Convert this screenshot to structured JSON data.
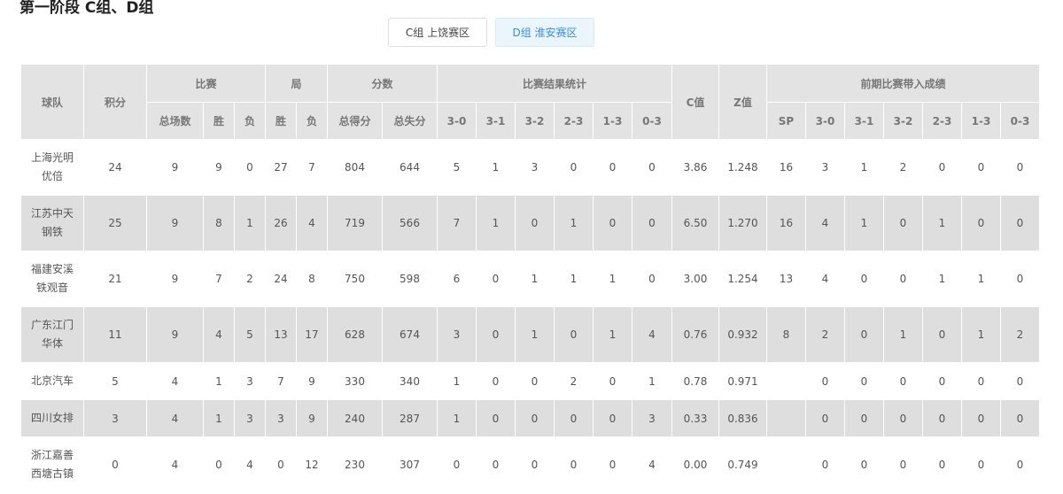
{
  "page_title": "第一阶段 C组、D组",
  "tabs": [
    {
      "label": "C组 上饶赛区",
      "active": false
    },
    {
      "label": "D组 淮安赛区",
      "active": true
    }
  ],
  "colors": {
    "active_tab_bg": "#eaf5fc",
    "active_tab_text": "#3a8ee6",
    "header_bg": "#e3e3e3",
    "stripe_bg": "#dedede"
  },
  "table": {
    "groups": {
      "team": "球队",
      "points": "积分",
      "matches": "比赛",
      "sets": "局",
      "scores": "分数",
      "result_stats": "比赛结果统计",
      "c_value": "C值",
      "z_value": "Z值",
      "prior": "前期比赛带入成绩"
    },
    "sub": {
      "matches": [
        "总场数",
        "胜",
        "负"
      ],
      "sets": [
        "胜",
        "负"
      ],
      "scores": [
        "总得分",
        "总失分"
      ],
      "result_stats": [
        "3-0",
        "3-1",
        "3-2",
        "2-3",
        "1-3",
        "0-3"
      ],
      "prior": [
        "SP",
        "3-0",
        "3-1",
        "3-2",
        "2-3",
        "1-3",
        "0-3"
      ]
    },
    "rows": [
      {
        "team": [
          "上海光明",
          "优倍"
        ],
        "cells": [
          "24",
          "9",
          "9",
          "0",
          "27",
          "7",
          "804",
          "644",
          "5",
          "1",
          "3",
          "0",
          "0",
          "0",
          "3.86",
          "1.248",
          "16",
          "3",
          "1",
          "2",
          "0",
          "0",
          "0"
        ]
      },
      {
        "team": [
          "江苏中天",
          "钢铁"
        ],
        "cells": [
          "25",
          "9",
          "8",
          "1",
          "26",
          "4",
          "719",
          "566",
          "7",
          "1",
          "0",
          "1",
          "0",
          "0",
          "6.50",
          "1.270",
          "16",
          "4",
          "1",
          "0",
          "1",
          "0",
          "0"
        ]
      },
      {
        "team": [
          "福建安溪",
          "铁观音"
        ],
        "cells": [
          "21",
          "9",
          "7",
          "2",
          "24",
          "8",
          "750",
          "598",
          "6",
          "0",
          "1",
          "1",
          "1",
          "0",
          "3.00",
          "1.254",
          "13",
          "4",
          "0",
          "0",
          "1",
          "1",
          "0"
        ]
      },
      {
        "team": [
          "广东江门",
          "华体"
        ],
        "cells": [
          "11",
          "9",
          "4",
          "5",
          "13",
          "17",
          "628",
          "674",
          "3",
          "0",
          "1",
          "0",
          "1",
          "4",
          "0.76",
          "0.932",
          "8",
          "2",
          "0",
          "1",
          "0",
          "1",
          "2"
        ]
      },
      {
        "team": [
          "北京汽车"
        ],
        "cells": [
          "5",
          "4",
          "1",
          "3",
          "7",
          "9",
          "330",
          "340",
          "1",
          "0",
          "0",
          "2",
          "0",
          "1",
          "0.78",
          "0.971",
          "",
          "0",
          "0",
          "0",
          "0",
          "0",
          "0"
        ]
      },
      {
        "team": [
          "四川女排"
        ],
        "cells": [
          "3",
          "4",
          "1",
          "3",
          "3",
          "9",
          "240",
          "287",
          "1",
          "0",
          "0",
          "0",
          "0",
          "3",
          "0.33",
          "0.836",
          "",
          "0",
          "0",
          "0",
          "0",
          "0",
          "0"
        ]
      },
      {
        "team": [
          "浙江嘉善",
          "西塘古镇"
        ],
        "cells": [
          "0",
          "4",
          "0",
          "4",
          "0",
          "12",
          "230",
          "307",
          "0",
          "0",
          "0",
          "0",
          "0",
          "4",
          "0.00",
          "0.749",
          "",
          "0",
          "0",
          "0",
          "0",
          "0",
          "0"
        ]
      }
    ]
  }
}
